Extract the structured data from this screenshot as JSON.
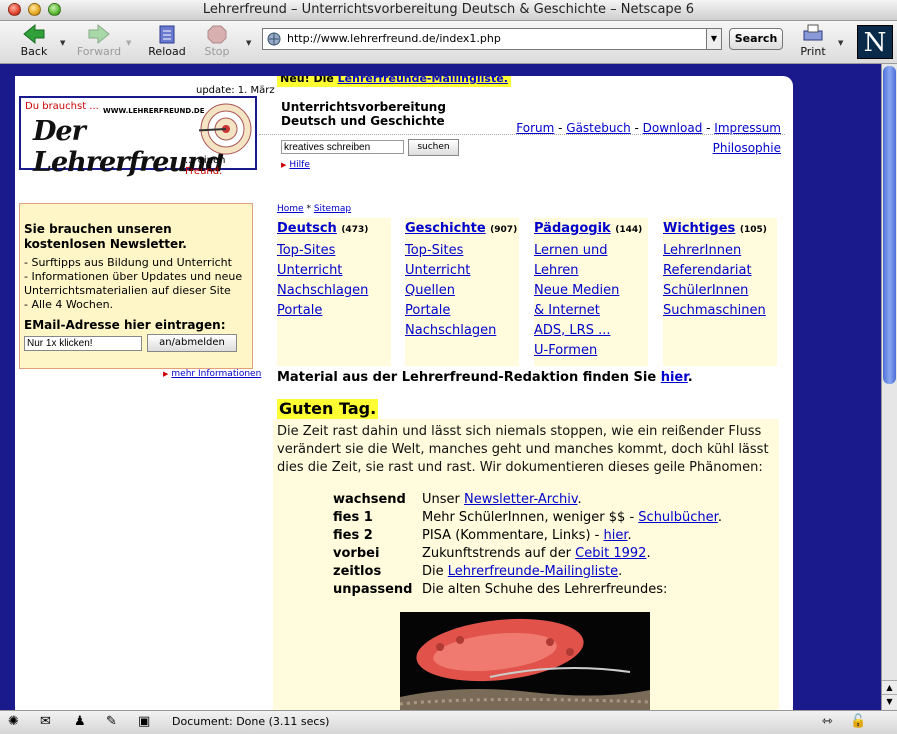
{
  "window": {
    "title": "Lehrerfreund – Unterrichtsvorbereitung Deutsch & Geschichte – Netscape 6"
  },
  "toolbar": {
    "back": "Back",
    "forward": "Forward",
    "reload": "Reload",
    "stop": "Stop",
    "url": "http://www.lehrerfreund.de/index1.php",
    "search": "Search",
    "print": "Print",
    "brand": "N"
  },
  "status": {
    "text": "Document: Done (3.11 secs)"
  },
  "colors": {
    "frame": "#1a1a8c",
    "highlight": "#ffff33",
    "panel": "#fffbdc",
    "link": "#0000cc"
  },
  "page": {
    "update": "update: 1. März",
    "promo_prefix": "Neu! Die ",
    "promo_link": "Lehrerfreunde-Mailingliste.",
    "logo": {
      "top": "Du brauchst ...",
      "url": "WWW.LEHRERFREUND.DE",
      "main": "Der Lehrerfreund",
      "bottom_prefix": "... einen ",
      "bottom_word": "Freund."
    },
    "subtitle_1": "Unterrichtsvorbereitung",
    "subtitle_2": "Deutsch und Geschichte",
    "nav": {
      "forum": "Forum",
      "gaestebuch": "Gästebuch",
      "download": "Download",
      "impressum": "Impressum",
      "philosophie": "Philosophie",
      "sep": " - "
    },
    "search": {
      "value": "kreatives schreiben",
      "button": "suchen",
      "help": "Hilfe"
    },
    "newsletter": {
      "title": "Sie brauchen unseren kostenlosen Newsletter.",
      "line1": "- Surftipps aus Bildung und Unterricht",
      "line2": "- Informationen über Updates und neue Unterrichtsmaterialien auf dieser Site",
      "line3": "- Alle 4 Wochen.",
      "label": "EMail-Adresse hier eintragen:",
      "email_value": "Nur 1x klicken!",
      "button": "an/abmelden",
      "more": "mehr Informationen"
    },
    "breadcrumb": {
      "home": "Home",
      "sep": " * ",
      "sitemap": "Sitemap"
    },
    "categories": [
      {
        "title": "Deutsch",
        "count": "(473)",
        "items": [
          "Top-Sites",
          "Unterricht",
          "Nachschlagen",
          "Portale"
        ]
      },
      {
        "title": "Geschichte",
        "count": "(907)",
        "items": [
          "Top-Sites",
          "Unterricht",
          "Quellen",
          "Portale",
          "Nachschlagen"
        ]
      },
      {
        "title": "Pädagogik",
        "count": "(144)",
        "items": [
          "Lernen und",
          "Lehren",
          "Neue Medien",
          "& Internet",
          "ADS, LRS ...",
          "U-Formen"
        ]
      },
      {
        "title": "Wichtiges",
        "count": "(105)",
        "items": [
          "LehrerInnen",
          "Referendariat",
          "SchülerInnen",
          "Suchmaschinen"
        ]
      }
    ],
    "material": {
      "text": "Material aus der Lehrerfreund-Redaktion finden Sie ",
      "link": "hier",
      "end": "."
    },
    "greeting": "Guten Tag.",
    "intro": "Die Zeit rast dahin und lässt sich niemals stoppen, wie ein reißender Fluss verändert sie die Welt, manches geht und manches kommt, doch kühl lässt dies die Zeit, sie rast und rast. Wir dokumentieren dieses geile Phänomen:",
    "facts": [
      {
        "key": "wachsend",
        "pre": "Unser ",
        "link": "Newsletter-Archiv",
        "post": "."
      },
      {
        "key": "fies 1",
        "pre": "Mehr SchülerInnen, weniger $$ - ",
        "link": "Schulbücher",
        "post": "."
      },
      {
        "key": "fies 2",
        "pre": "PISA (Kommentare, Links) - ",
        "link": "hier",
        "post": "."
      },
      {
        "key": "vorbei",
        "pre": "Zukunftstrends auf der ",
        "link": "Cebit 1992",
        "post": "."
      },
      {
        "key": "zeitlos",
        "pre": "Die ",
        "link": "Lehrerfreunde-Mailingliste",
        "post": "."
      },
      {
        "key": "unpassend",
        "pre": "Die alten Schuhe des Lehrerfreundes:",
        "link": "",
        "post": ""
      }
    ]
  }
}
